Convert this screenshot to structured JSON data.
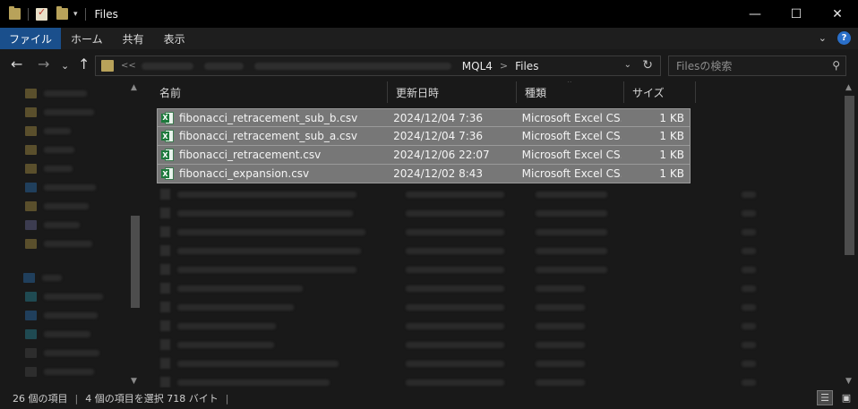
{
  "window": {
    "title": "Files",
    "controls": {
      "minimize": "—",
      "maximize": "☐",
      "close": "✕"
    }
  },
  "quick_access": {
    "dropdown_glyph": "▾"
  },
  "ribbon": {
    "tabs": [
      "ファイル",
      "ホーム",
      "共有",
      "表示"
    ],
    "collapse_glyph": "⌄",
    "help_glyph": "?"
  },
  "nav": {
    "back": "←",
    "forward": "→",
    "recent": "⌄",
    "up": "↑"
  },
  "address": {
    "overflow": "<<",
    "crumbs": [
      "MQL4",
      "Files"
    ],
    "separator": ">",
    "dropdown": "⌄",
    "refresh": "↻"
  },
  "search": {
    "placeholder": "Filesの検索",
    "icon": "search-icon"
  },
  "columns": {
    "name": "名前",
    "date": "更新日時",
    "type": "種類",
    "size": "サイズ",
    "sort_indicator": "⌃"
  },
  "files": [
    {
      "name": "fibonacci_retracement_sub_b.csv",
      "date": "2024/12/04 7:36",
      "type": "Microsoft Excel CS...",
      "size": "1 KB"
    },
    {
      "name": "fibonacci_retracement_sub_a.csv",
      "date": "2024/12/04 7:36",
      "type": "Microsoft Excel CS...",
      "size": "1 KB"
    },
    {
      "name": "fibonacci_retracement.csv",
      "date": "2024/12/06 22:07",
      "type": "Microsoft Excel CS...",
      "size": "1 KB"
    },
    {
      "name": "fibonacci_expansion.csv",
      "date": "2024/12/02 8:43",
      "type": "Microsoft Excel CS...",
      "size": "1 KB"
    }
  ],
  "file_icon_letter": "X",
  "scroll": {
    "up": "▲",
    "down": "▼"
  },
  "status": {
    "item_count": "26 個の項目",
    "selection": "4 個の項目を選択  718 バイト"
  },
  "colors": {
    "selection_bg": "#777777",
    "accent_file_tab": "#1a4f8c",
    "folder": "#b8a25a",
    "excel_green": "#1d7a3c"
  }
}
